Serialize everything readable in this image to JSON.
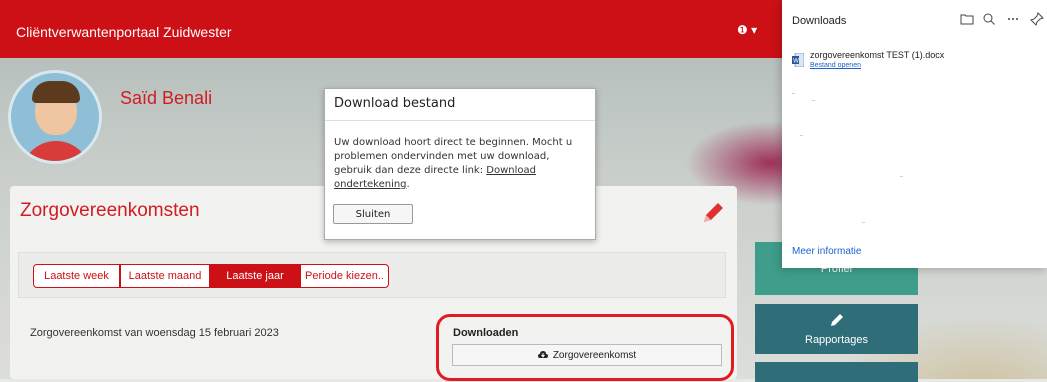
{
  "header": {
    "app_title": "Cliëntverwantenportaal Zuidwester",
    "info_menu": "❶ ▾"
  },
  "profile": {
    "name": "Saïd Benali"
  },
  "agreements": {
    "title": "Zorgovereenkomsten",
    "tabs": [
      {
        "label": "Laatste week",
        "active": false
      },
      {
        "label": "Laatste maand",
        "active": false
      },
      {
        "label": "Laatste jaar",
        "active": true
      },
      {
        "label": "Periode kiezen..",
        "active": false
      }
    ],
    "row_label": "Zorgovereenkomst van woensdag 15 februari 2023",
    "downloads_label": "Downloaden",
    "download_button": "Zorgovereenkomst"
  },
  "side_tiles": {
    "profile": "Profiel",
    "reports": "Rapportages"
  },
  "modal": {
    "title": "Download bestand",
    "body_text": "Uw download hoort direct te beginnen. Mocht u problemen ondervinden met uw download, gebruik dan deze directe link:",
    "link_text": "Download ondertekening",
    "link_suffix": ".",
    "close_button": "Sluiten"
  },
  "browser_downloads": {
    "title": "Downloads",
    "tools": [
      "folder-icon",
      "search-icon",
      "more-icon",
      "pin-icon"
    ],
    "file_name": "zorgovereenkomst TEST (1).docx",
    "open_file": "Bestand openen",
    "more_info": "Meer informatie"
  },
  "colors": {
    "brand_red": "#cc1016",
    "tile_teal": "#3f9d8b",
    "tile_dark": "#2f6e78",
    "link_blue": "#1a66c9"
  }
}
